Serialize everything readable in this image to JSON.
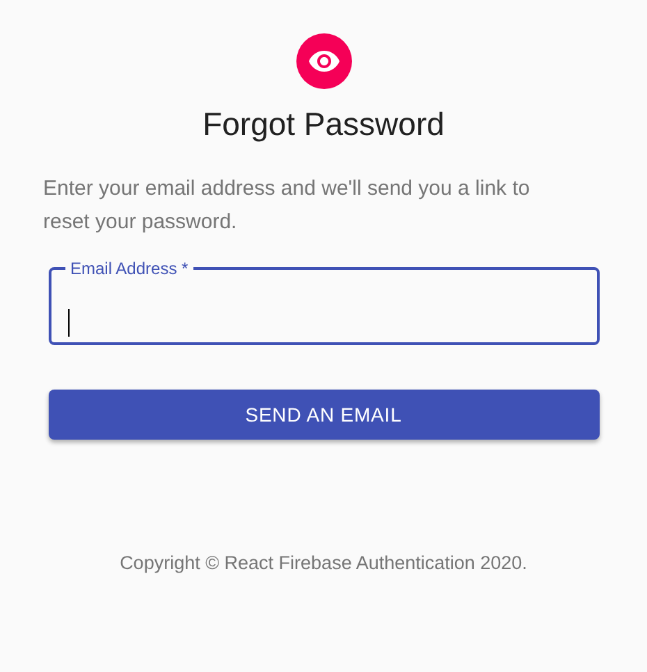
{
  "title": "Forgot Password",
  "description": "Enter your email address and we'll send you a link to reset your password.",
  "email_field": {
    "label": "Email Address *",
    "focused": true
  },
  "submit_button": {
    "label": "SEND AN EMAIL"
  },
  "footer": {
    "copyright": "Copyright © React Firebase Authentication 2020."
  }
}
